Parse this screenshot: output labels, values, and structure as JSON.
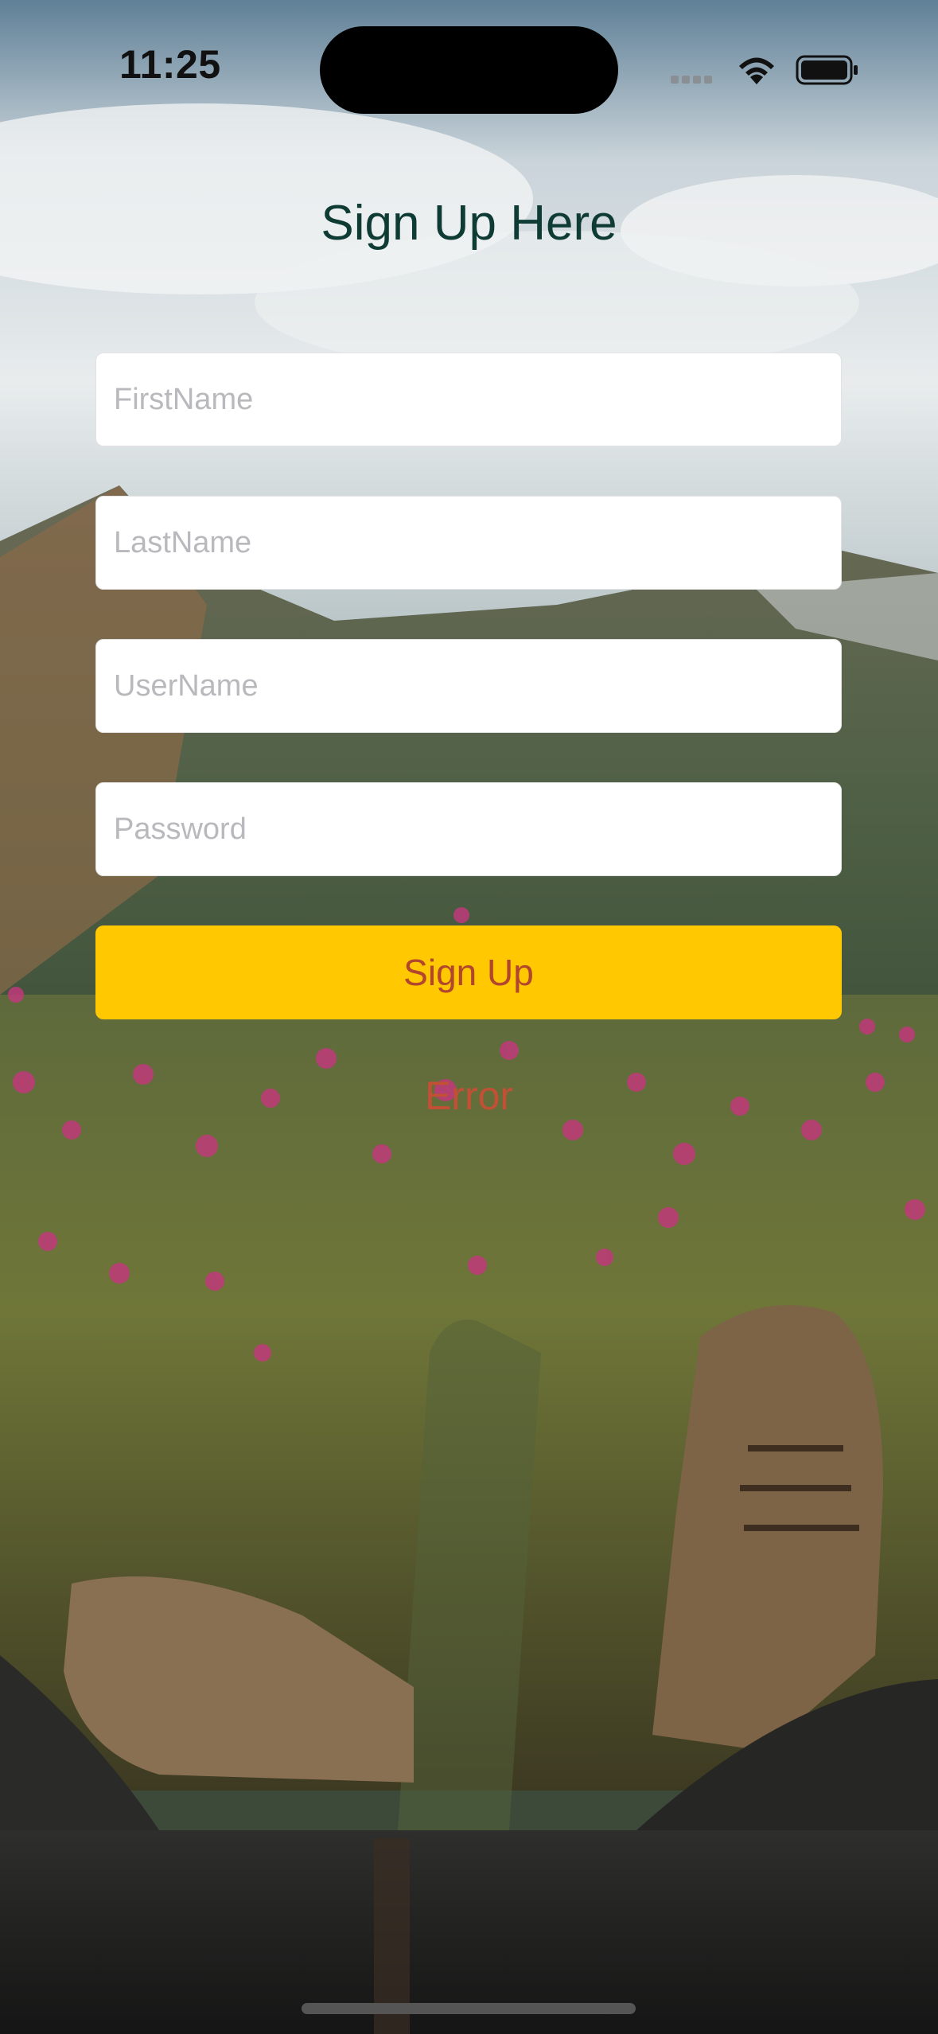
{
  "status_bar": {
    "time": "11:25"
  },
  "form": {
    "title": "Sign Up Here",
    "fields": [
      {
        "name": "firstname",
        "placeholder": "FirstName",
        "value": ""
      },
      {
        "name": "lastname",
        "placeholder": "LastName",
        "value": ""
      },
      {
        "name": "username",
        "placeholder": "UserName",
        "value": ""
      },
      {
        "name": "password",
        "placeholder": "Password",
        "value": ""
      }
    ],
    "submit_label": "Sign Up",
    "error_text": "Error"
  },
  "colors": {
    "button": "#ffc800",
    "button_text": "#b1452e",
    "title": "#0f3b35",
    "error": "#c25035"
  },
  "icons": [
    "cellular-signal-icon",
    "wifi-icon",
    "battery-icon"
  ]
}
